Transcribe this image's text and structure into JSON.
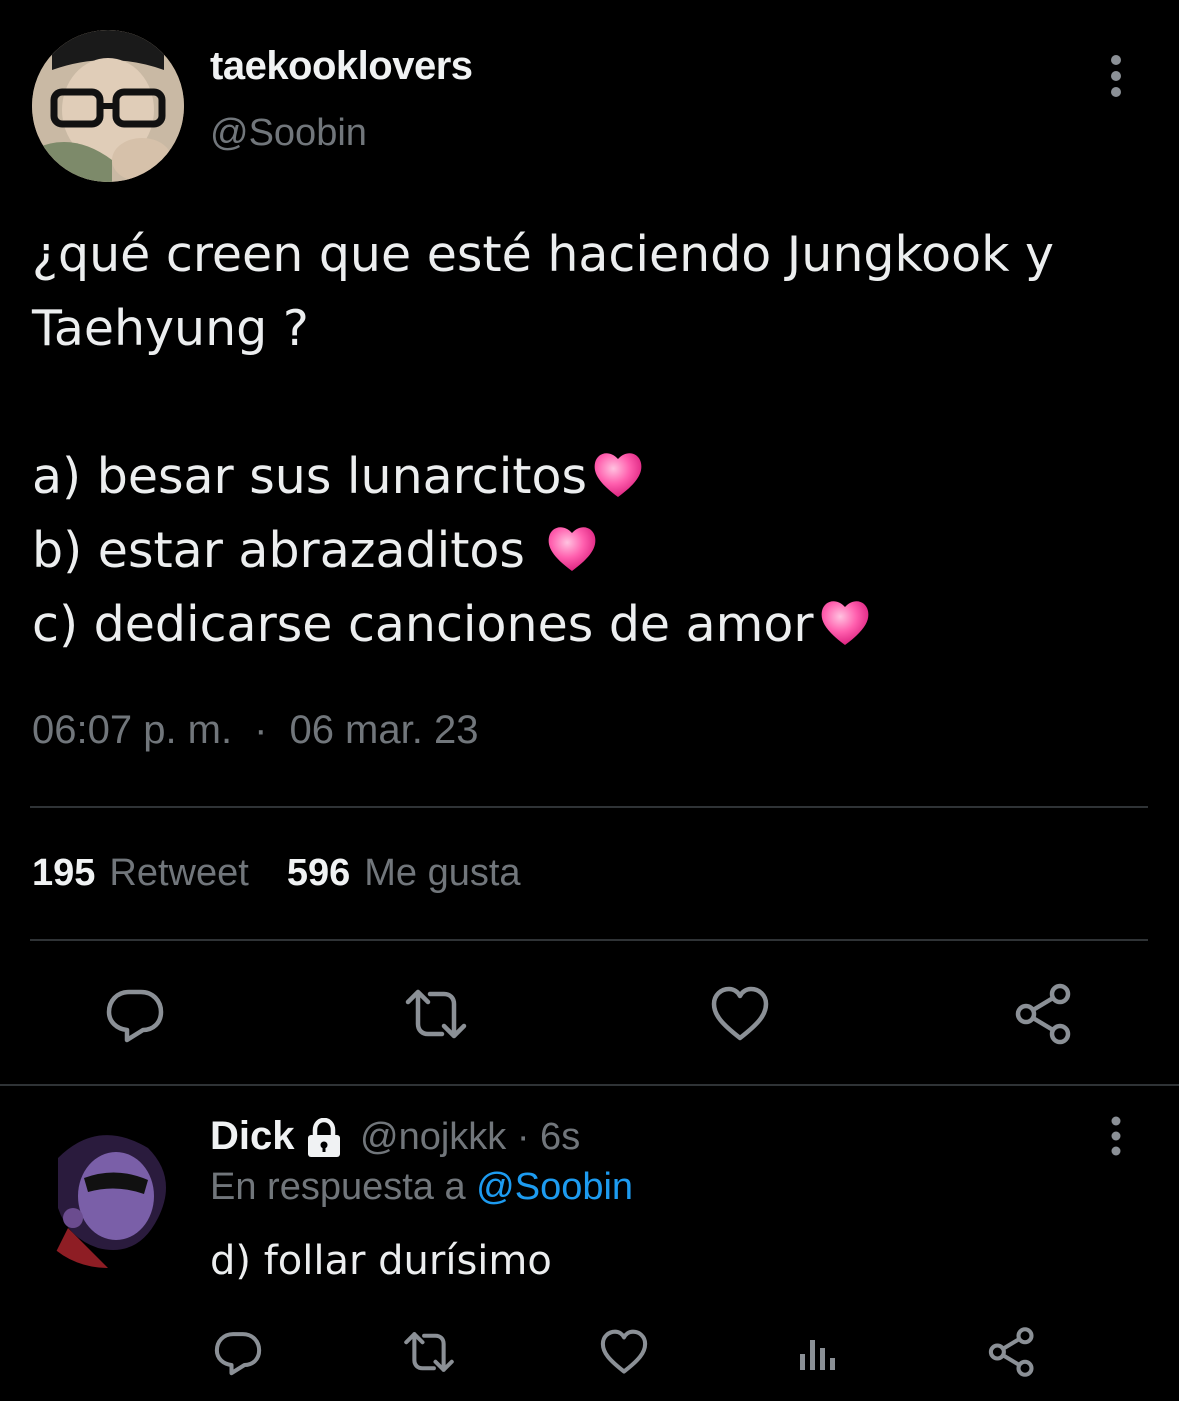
{
  "tweet": {
    "author_name": "taekooklovers",
    "author_handle": "@Soobin",
    "text_lines": [
      "¿qué creen que esté haciendo Jungkook y",
      "Taehyung ?",
      "",
      "a) besar sus lunarcitos",
      "b) estar abrazaditos ",
      "c) dedicarse canciones de amor"
    ],
    "emoji": "sparkling-heart",
    "time": "06:07 p. m.",
    "separator": "·",
    "date": "06 mar. 23",
    "retweet_count": "195",
    "retweet_label": "Retweet",
    "like_count": "596",
    "like_label": "Me gusta"
  },
  "reply": {
    "author_name": "Dick",
    "author_handle": "@nojkkk · 6s",
    "reply_prefix": "En respuesta a ",
    "reply_mention": "@Soobin",
    "text": "d) follar durísimo"
  },
  "colors": {
    "background": "#000000",
    "text_primary": "#e7e9ea",
    "text_secondary": "#71767b",
    "accent": "#1d9bf0",
    "divider": "#2f3336",
    "heart_pink": "#ff4fa3"
  },
  "icons": {
    "actions": [
      "reply-icon",
      "retweet-icon",
      "like-icon",
      "share-icon"
    ],
    "reply_actions": [
      "reply-icon",
      "retweet-icon",
      "like-icon",
      "analytics-icon",
      "share-icon"
    ]
  }
}
